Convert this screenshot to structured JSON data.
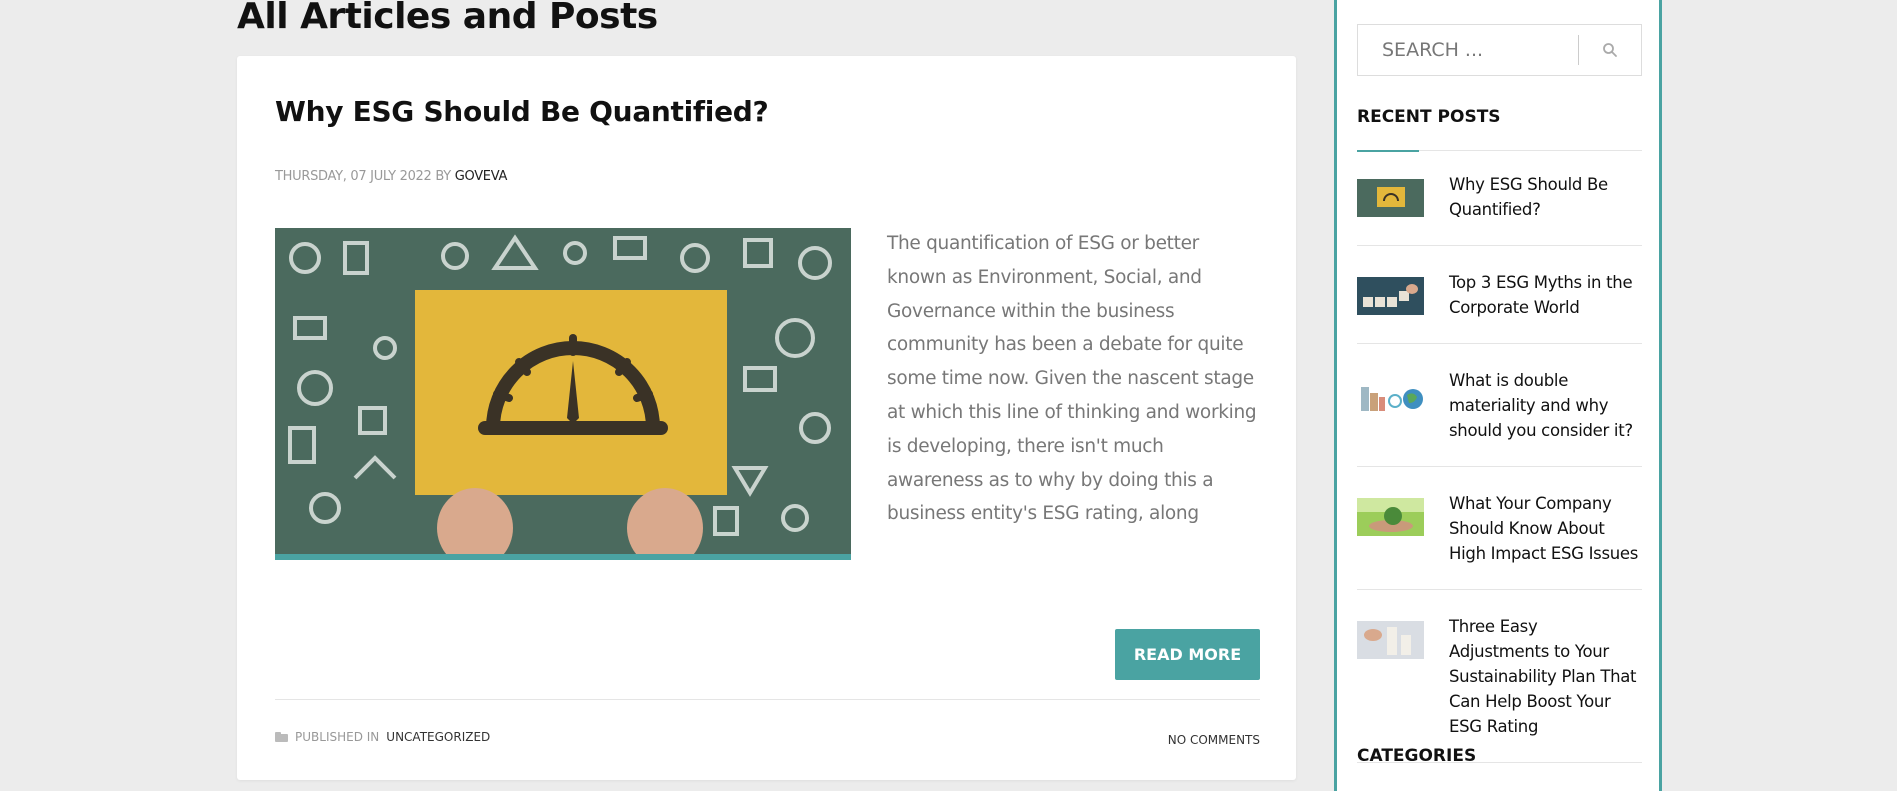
{
  "page": {
    "heading": "All Articles and Posts"
  },
  "article": {
    "title": "Why ESG Should Be Quantified?",
    "date": "THURSDAY, 07 JULY 2022",
    "by": "BY",
    "author": "GOVEVA",
    "excerpt": "The quantification of ESG or better known as Environment, Social, and Governance within the business community has been a debate for quite some time now. Given the nascent stage at which this line of thinking and working is developing, there isn't much awareness as to why by doing this a business entity's ESG rating, along",
    "read_more": "READ MORE",
    "published_in_label": "PUBLISHED IN",
    "category": "UNCATEGORIZED",
    "comments": "NO COMMENTS"
  },
  "sidebar": {
    "search_placeholder": "SEARCH ...",
    "recent_posts_title": "RECENT POSTS",
    "recent_posts": [
      {
        "title": "Why ESG Should Be Quantified?",
        "thumb": "gauge-thumb"
      },
      {
        "title": "Top 3 ESG Myths in the Corporate World",
        "thumb": "blocks-thumb"
      },
      {
        "title": "What is double materiality and why should you consider it?",
        "thumb": "city-globe-thumb"
      },
      {
        "title": "What Your Company Should Know About High Impact ESG Issues",
        "thumb": "plant-hand-thumb"
      },
      {
        "title": "Three Easy Adjustments to Your Sustainability Plan That Can Help Boost Your ESG Rating",
        "thumb": "cubes-thumb"
      }
    ],
    "categories_title": "CATEGORIES"
  },
  "colors": {
    "accent": "#4aa3a2",
    "background": "#ececec",
    "image_green": "#4b6a5e",
    "image_yellow": "#e3b73b"
  }
}
